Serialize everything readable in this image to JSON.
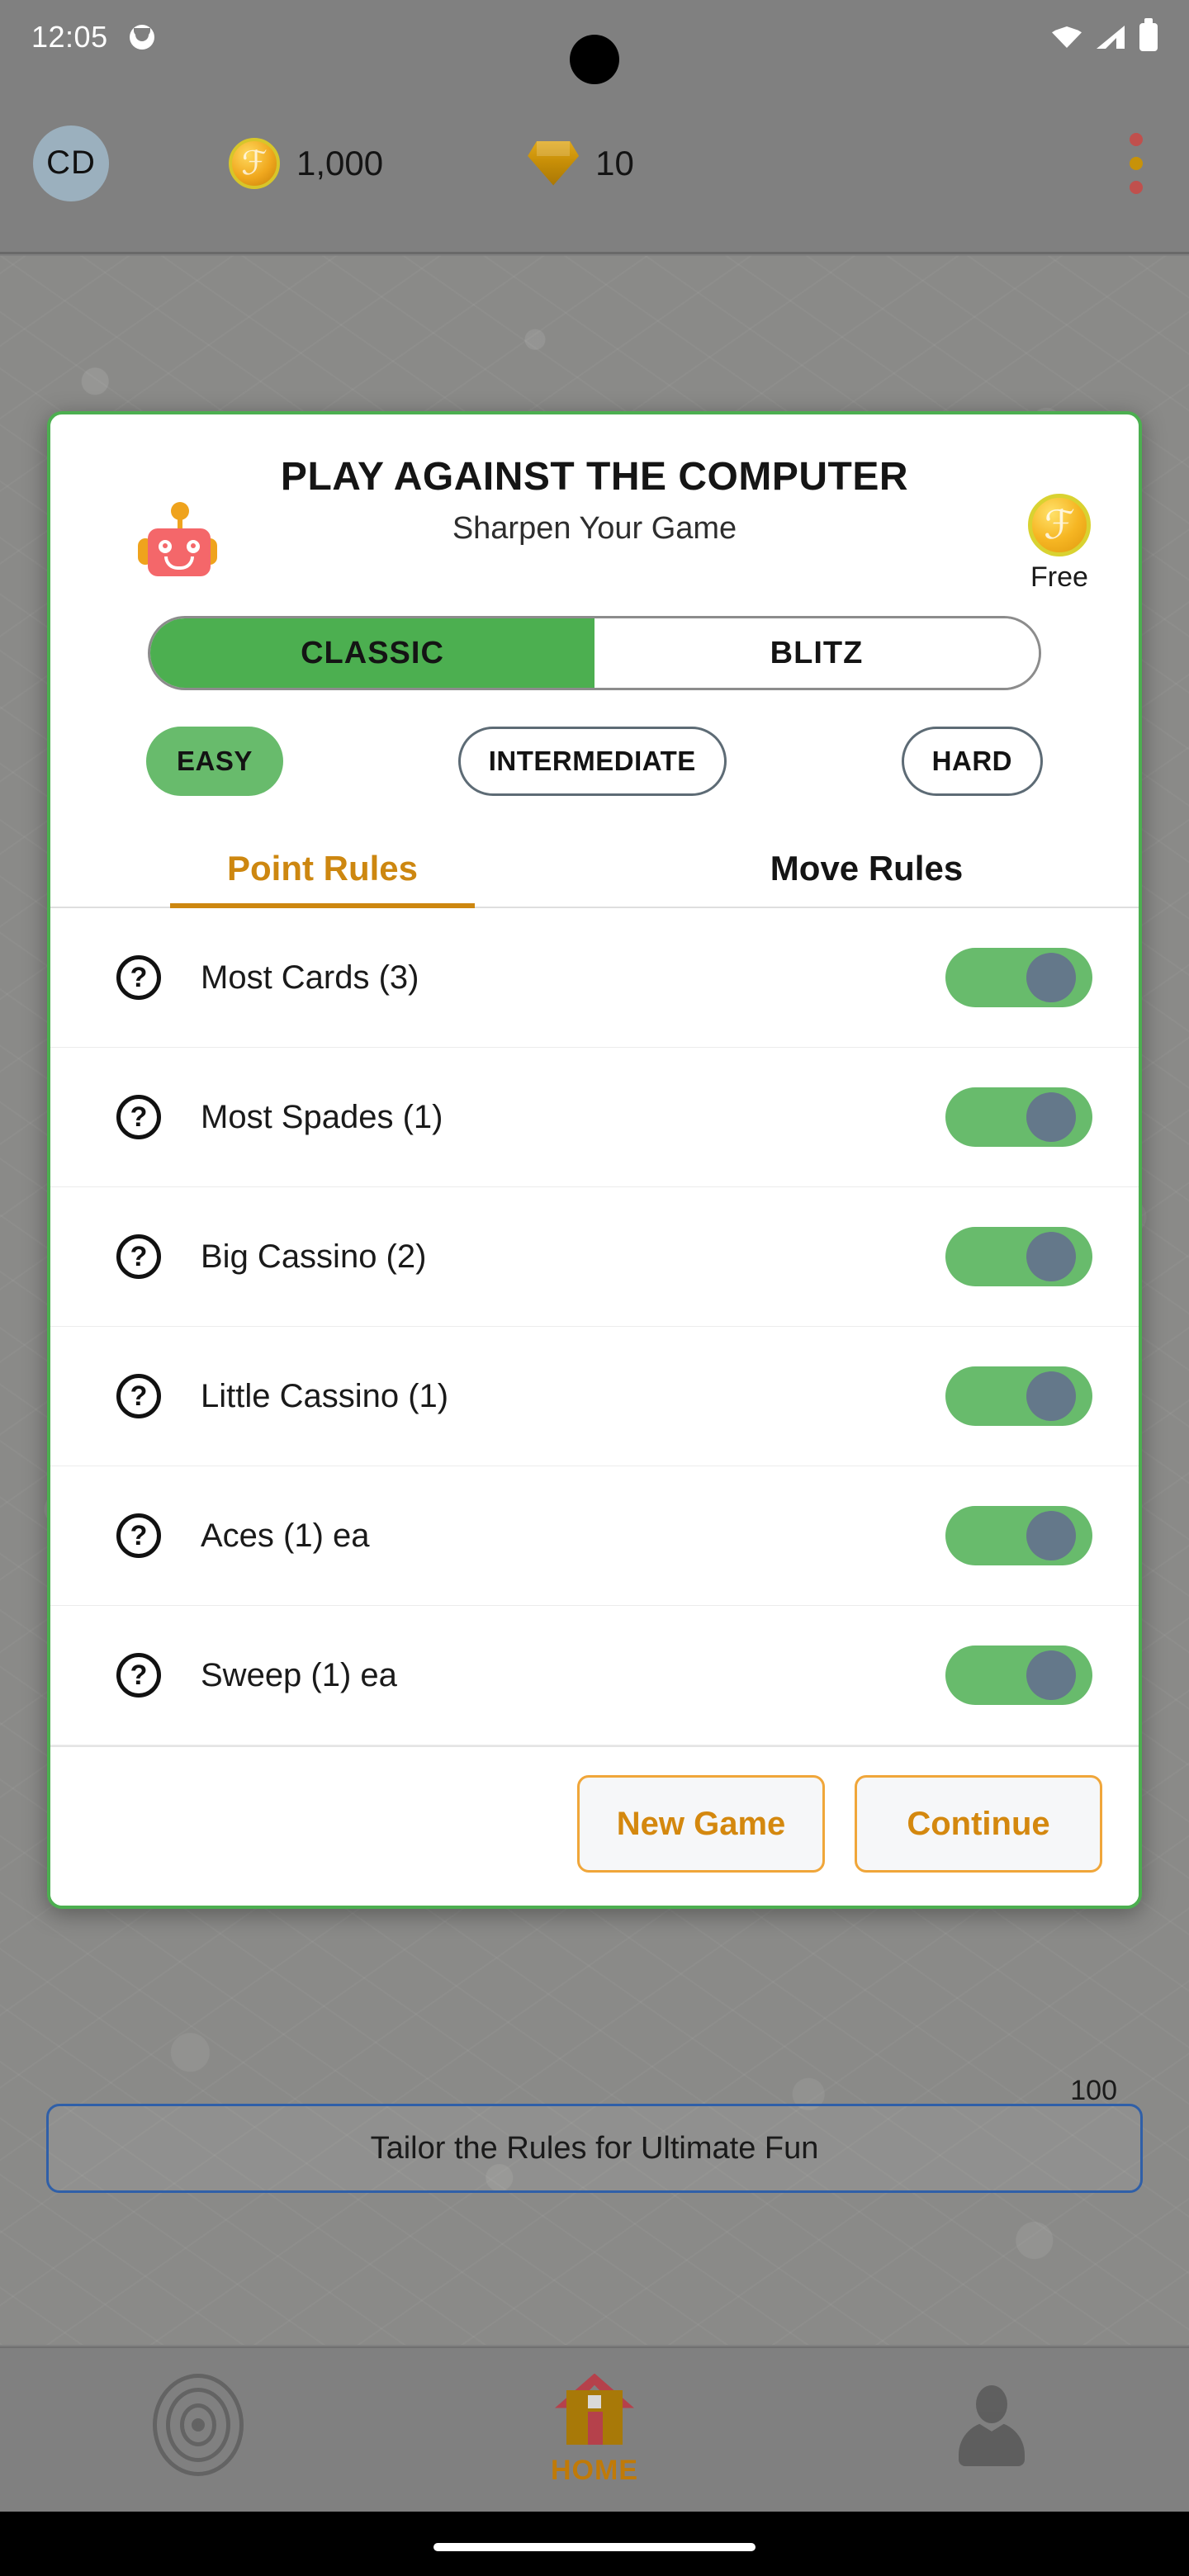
{
  "status_bar": {
    "time": "12:05",
    "app_icon": "notification-app-icon",
    "wifi_icon": "wifi-icon",
    "signal_icon": "cellular-signal-icon",
    "battery_icon": "battery-icon"
  },
  "top_bar": {
    "avatar_initials": "CD",
    "coin_icon": "gold-coin-icon",
    "coins": "1,000",
    "gem_icon": "gem-icon",
    "gems": "10",
    "overflow_icon": "overflow-menu-icon",
    "overflow_dot_colors": [
      "#c0504d",
      "#c79209",
      "#c0504d"
    ]
  },
  "background": {
    "card_text": "Tailor the Rules for Ultimate Fun",
    "card_badge": "100",
    "card_border_color": "#2f5fa8"
  },
  "dialog": {
    "border_color": "#4caf50",
    "title": "PLAY AGAINST THE COMPUTER",
    "subtitle": "Sharpen Your Game",
    "robot_icon": "robot-icon",
    "cost_coin_icon": "gold-coin-icon",
    "cost_label": "Free",
    "modes": [
      {
        "label": "CLASSIC",
        "selected": true
      },
      {
        "label": "BLITZ",
        "selected": false
      }
    ],
    "difficulties": [
      {
        "label": "EASY",
        "selected": true
      },
      {
        "label": "INTERMEDIATE",
        "selected": false
      },
      {
        "label": "HARD",
        "selected": false
      }
    ],
    "tabs": [
      {
        "label": "Point Rules",
        "active": true
      },
      {
        "label": "Move Rules",
        "active": false
      }
    ],
    "rules": [
      {
        "help_icon": "help-icon",
        "label": "Most Cards (3)",
        "enabled": true
      },
      {
        "help_icon": "help-icon",
        "label": "Most Spades (1)",
        "enabled": true
      },
      {
        "help_icon": "help-icon",
        "label": "Big Cassino (2)",
        "enabled": true
      },
      {
        "help_icon": "help-icon",
        "label": "Little Cassino (1)",
        "enabled": true
      },
      {
        "help_icon": "help-icon",
        "label": "Aces (1) ea",
        "enabled": true
      },
      {
        "help_icon": "help-icon",
        "label": "Sweep (1) ea",
        "enabled": true
      }
    ],
    "footer": {
      "new_game_label": "New Game",
      "continue_label": "Continue",
      "accent_color": "#d4880f"
    }
  },
  "bottom_nav": [
    {
      "icon": "broadcast-icon",
      "label": "",
      "active": false
    },
    {
      "icon": "home-icon",
      "label": "HOME",
      "active": true
    },
    {
      "icon": "profile-icon",
      "label": "",
      "active": false
    }
  ],
  "colors": {
    "green": "#4caf50",
    "chip_green": "#68bb6c",
    "orange": "#cd8710",
    "toggle_thumb": "#64788a"
  }
}
